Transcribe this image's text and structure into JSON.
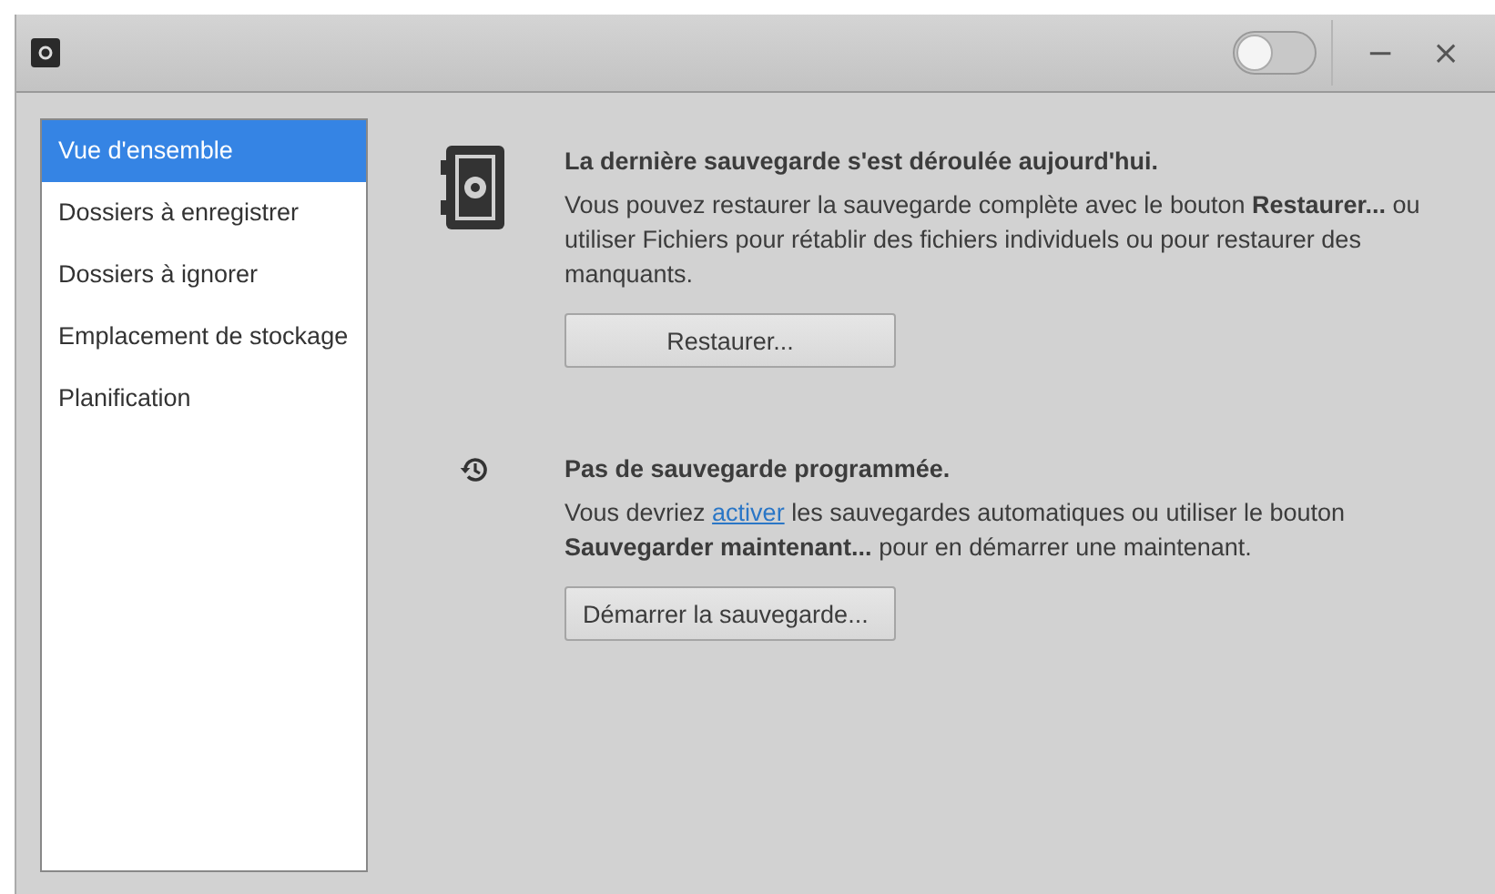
{
  "titlebar": {
    "toggle": {
      "on": false
    },
    "buttons": [
      "−",
      "×"
    ]
  },
  "sidebar": {
    "items": [
      {
        "label": "Vue d'ensemble",
        "selected": true
      },
      {
        "label": "Dossiers à enregistrer",
        "selected": false
      },
      {
        "label": "Dossiers à ignorer",
        "selected": false
      },
      {
        "label": "Emplacement de stockage",
        "selected": false
      },
      {
        "label": "Planification",
        "selected": false
      }
    ]
  },
  "sections": [
    {
      "kind": "safe",
      "title": "La dernière sauvegarde s'est déroulée aujourd'hui.",
      "text": "Vous pouvez restaurer la sauvegarde complète avec le bouton **Restaurer...** ou utiliser Fichiers pour rétablir des fichiers individuels ou pour restaurer des manquants.",
      "button": "Restaurer..."
    },
    {
      "kind": "history",
      "title": "Pas de sauvegarde programmée.",
      "text_before": "Vous devriez",
      "link": "activer",
      "text_after": "les sauvegardes automatiques ou utiliser le bouton **Sauvegarder maintenant...** pour en démarrer une maintenant.",
      "button": "Démarrer la sauvegarde..."
    }
  ]
}
